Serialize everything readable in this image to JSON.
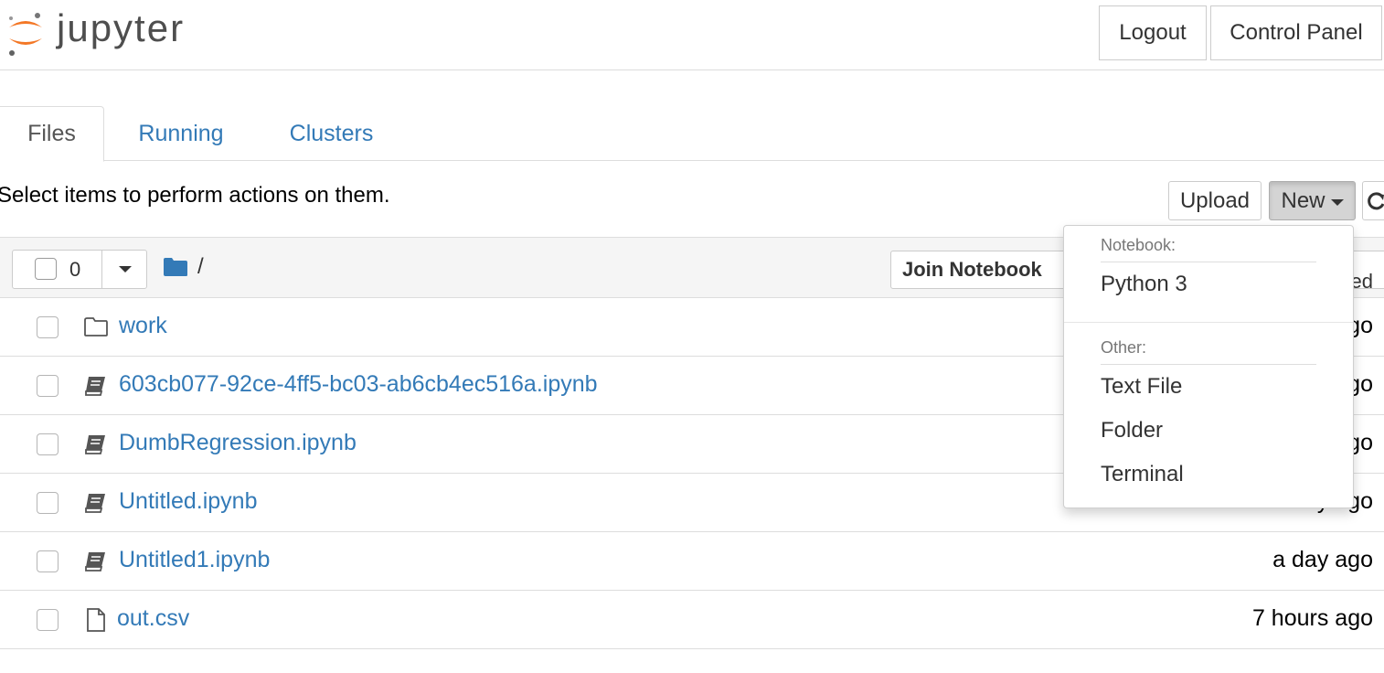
{
  "header": {
    "logo_text": "jupyter",
    "logout_label": "Logout",
    "control_panel_label": "Control Panel"
  },
  "tabs": [
    {
      "label": "Files",
      "active": true
    },
    {
      "label": "Running",
      "active": false
    },
    {
      "label": "Clusters",
      "active": false
    }
  ],
  "toolbar": {
    "hint": "Select items to perform actions on them.",
    "upload_label": "Upload",
    "new_label": "New",
    "refresh_icon": "refresh-icon"
  },
  "list_header": {
    "selected_count": "0",
    "path": "/",
    "join_notebook_label": "Join Notebook",
    "sort_label": "Last Modified"
  },
  "files": [
    {
      "name": "work",
      "type": "folder",
      "icon": "folder-icon",
      "modified": "a day ago"
    },
    {
      "name": "603cb077-92ce-4ff5-bc03-ab6cb4ec516a.ipynb",
      "type": "notebook",
      "icon": "notebook-icon",
      "modified": "a day ago"
    },
    {
      "name": "DumbRegression.ipynb",
      "type": "notebook",
      "icon": "notebook-icon",
      "modified": "a day ago"
    },
    {
      "name": "Untitled.ipynb",
      "type": "notebook",
      "icon": "notebook-icon",
      "modified": "a day ago"
    },
    {
      "name": "Untitled1.ipynb",
      "type": "notebook",
      "icon": "notebook-icon",
      "modified": "a day ago"
    },
    {
      "name": "out.csv",
      "type": "file",
      "icon": "file-icon",
      "modified": "7 hours ago"
    }
  ],
  "new_menu": {
    "notebook_header": "Notebook:",
    "notebook_items": [
      "Python 3"
    ],
    "other_header": "Other:",
    "other_items": [
      "Text File",
      "Folder",
      "Terminal"
    ]
  },
  "colors": {
    "link": "#337ab7",
    "logo_orange": "#f37726",
    "logo_gray": "#616262"
  }
}
